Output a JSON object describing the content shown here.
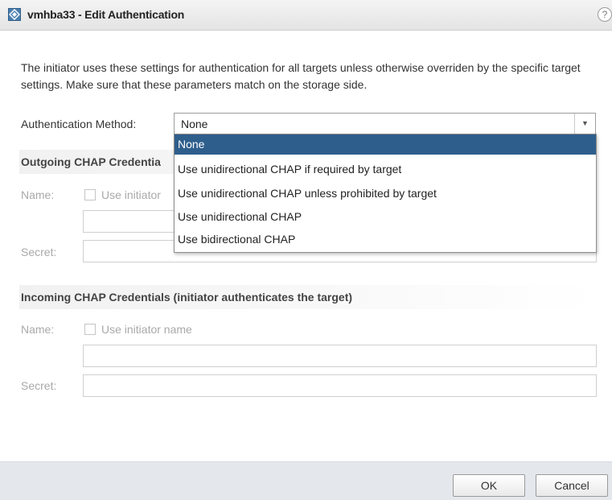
{
  "dialog": {
    "title": "vmhba33 - Edit Authentication",
    "help_icon": "help-icon",
    "help_glyph": "?"
  },
  "description": "The initiator uses these settings for authentication for all targets unless otherwise overriden by the specific target settings. Make sure that these parameters match on the storage side.",
  "auth_method": {
    "label": "Authentication Method:",
    "selected_value": "None",
    "options": [
      "None",
      "Use unidirectional CHAP if required by target",
      "Use unidirectional CHAP unless prohibited by target",
      "Use unidirectional CHAP",
      "Use bidirectional CHAP"
    ]
  },
  "outgoing": {
    "heading": "Outgoing CHAP Credentia",
    "name_label": "Name:",
    "use_initiator_label": "Use initiator",
    "secret_label": "Secret:"
  },
  "incoming": {
    "heading": "Incoming CHAP Credentials (initiator authenticates the target)",
    "name_label": "Name:",
    "use_initiator_label": "Use initiator name",
    "secret_label": "Secret:"
  },
  "footer": {
    "ok_label": "OK",
    "cancel_label": "Cancel"
  },
  "colors": {
    "selected_option_bg": "#2e5e8c",
    "footer_bg": "#e4e8ec",
    "disabled_text": "#a9a9a9"
  }
}
